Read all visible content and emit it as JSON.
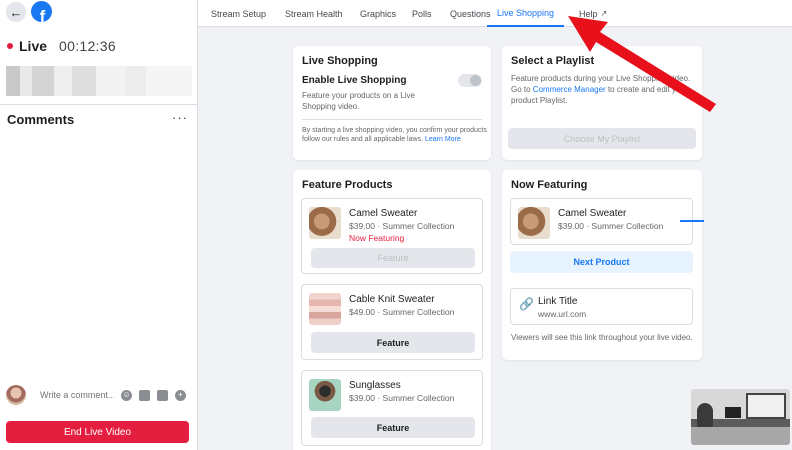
{
  "header": {
    "back_icon": "arrow-left-icon",
    "logo_letter": "f",
    "live_label": "Live",
    "timer": "00:12:36"
  },
  "comments": {
    "title": "Comments",
    "more": "···",
    "input_placeholder": "Write a comment...",
    "icons": [
      "emoji-icon",
      "gif-icon",
      "sticker-icon",
      "add-icon"
    ],
    "end_button": "End Live Video"
  },
  "tabs": [
    {
      "label": "Stream Setup"
    },
    {
      "label": "Stream Health"
    },
    {
      "label": "Graphics"
    },
    {
      "label": "Polls"
    },
    {
      "label": "Questions"
    },
    {
      "label": "Live Shopping",
      "active": true
    },
    {
      "label": "Help",
      "icon": "external-link-icon"
    }
  ],
  "live_shopping": {
    "title": "Live Shopping",
    "toggle_label": "Enable Live Shopping",
    "toggle_on": false,
    "description": "Feature your products on a Live Shopping video.",
    "legal_text": "By starting a live shopping video, you confirm your products follow our rules and all applicable laws.",
    "learn_more": "Learn More"
  },
  "playlist": {
    "title": "Select a Playlist",
    "desc_before": "Feature products during your Live Shopping video. Go to ",
    "desc_link": "Commerce Manager",
    "desc_after": " to create and edit your product Playlist.",
    "button": "Choose My Playlist"
  },
  "feature_products": {
    "title": "Feature Products",
    "items": [
      {
        "name": "Camel Sweater",
        "meta": "$39.00 · Summer Collection",
        "status": "Now Featuring",
        "button": "Feature",
        "button_disabled": true
      },
      {
        "name": "Cable Knit Sweater",
        "meta": "$49.00 · Summer Collection",
        "status": "",
        "button": "Feature",
        "button_disabled": false
      },
      {
        "name": "Sunglasses",
        "meta": "$39.00 · Summer Collection",
        "status": "",
        "button": "Feature",
        "button_disabled": false
      }
    ]
  },
  "now_featuring": {
    "title": "Now Featuring",
    "product": {
      "name": "Camel Sweater",
      "meta": "$39.00 · Summer Collection"
    },
    "next_button": "Next Product",
    "link_title": "Link Title",
    "link_url": "www.url.com",
    "note": "Viewers will see this link throughout your live video."
  },
  "colors": {
    "accent": "#1877f2",
    "live_red": "#e41e3f",
    "annotation_arrow": "#e8101b"
  }
}
